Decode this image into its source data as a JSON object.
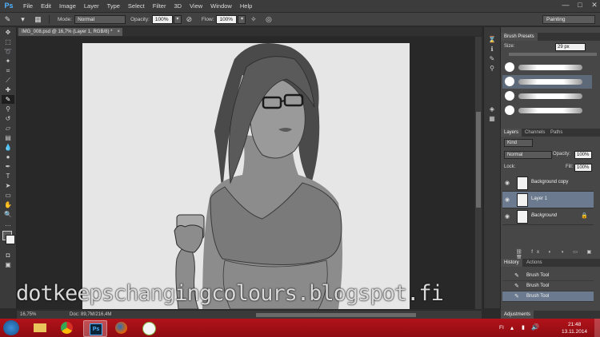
{
  "app": {
    "logo": "Ps"
  },
  "menu": [
    "File",
    "Edit",
    "Image",
    "Layer",
    "Type",
    "Select",
    "Filter",
    "3D",
    "View",
    "Window",
    "Help"
  ],
  "window_controls": [
    "—",
    "□",
    "✕"
  ],
  "options": {
    "mode_label": "Mode:",
    "mode_value": "Normal",
    "opacity_label": "Opacity:",
    "opacity_value": "100%",
    "flow_label": "Flow:",
    "flow_value": "100%",
    "workspace": "Painting"
  },
  "document": {
    "tab_title": "IMG_008.psd @ 16,7% (Layer 1, RGB/8) *"
  },
  "status": {
    "zoom": "16,75%",
    "doc_size": "Doc: 89,7M/216,4M"
  },
  "brush_presets": {
    "tab": "Brush Presets",
    "size_label": "Size:",
    "size_value": "29 px"
  },
  "layers_panel": {
    "tabs": [
      "Layers",
      "Channels",
      "Paths"
    ],
    "kind_filter": "Kind",
    "blend_mode": "Normal",
    "opacity_label": "Opacity:",
    "opacity_value": "100%",
    "lock_label": "Lock:",
    "fill_label": "Fill:",
    "fill_value": "100%",
    "layers": [
      {
        "name": "Background copy"
      },
      {
        "name": "Layer 1"
      },
      {
        "name": "Background"
      }
    ]
  },
  "history_panel": {
    "tabs": [
      "History",
      "Actions"
    ],
    "items": [
      {
        "name": "Brush Tool"
      },
      {
        "name": "Brush Tool"
      },
      {
        "name": "Brush Tool"
      }
    ]
  },
  "adjustments_tab": "Adjustments",
  "watermark": "dotkeepschangingcolours.blogspot.fi",
  "taskbar": {
    "language": "FI",
    "time": "21:48",
    "date": "13.11.2014"
  }
}
